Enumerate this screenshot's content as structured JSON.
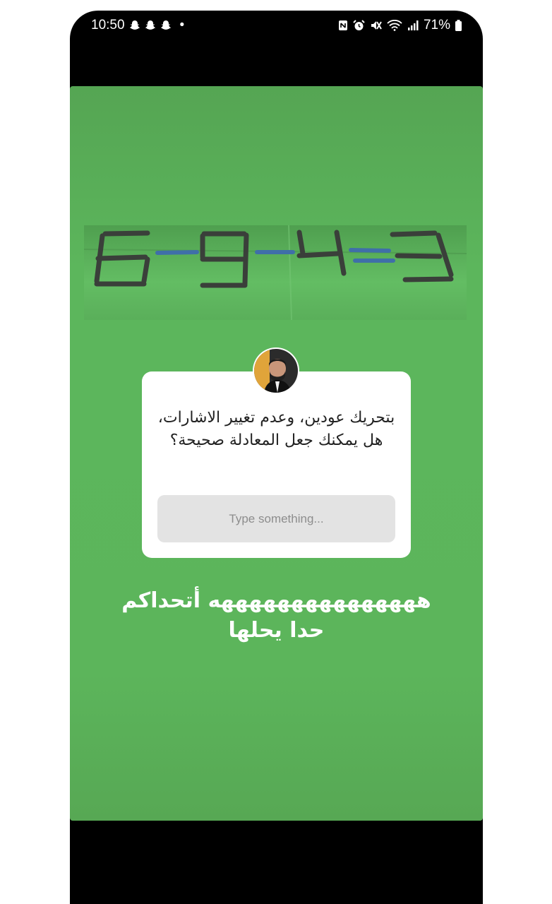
{
  "status_bar": {
    "time": "10:50",
    "notification_icons": [
      "snapchat-icon",
      "snapchat-icon",
      "snapchat-icon"
    ],
    "dot": "•",
    "right_icons": [
      "nfc-icon",
      "alarm-icon",
      "mute-icon",
      "wifi-icon",
      "signal-icon"
    ],
    "battery": "71%"
  },
  "story": {
    "puzzle_equation": "6-9-4=3",
    "question_text": "بتحريك عودين، وعدم تغيير الاشارات، هل يمكنك جعل المعادلة صحيحة؟",
    "answer_placeholder": "Type something...",
    "caption_line1": "هههههههههههههههه أتحداكم",
    "caption_line2": "حدا يحلها"
  },
  "colors": {
    "story_background": "#5cb55b",
    "matchstick": "#3a3f3a",
    "sign_stick": "#3f6fa8",
    "card": "#ffffff",
    "answer_field": "#e3e3e3"
  }
}
